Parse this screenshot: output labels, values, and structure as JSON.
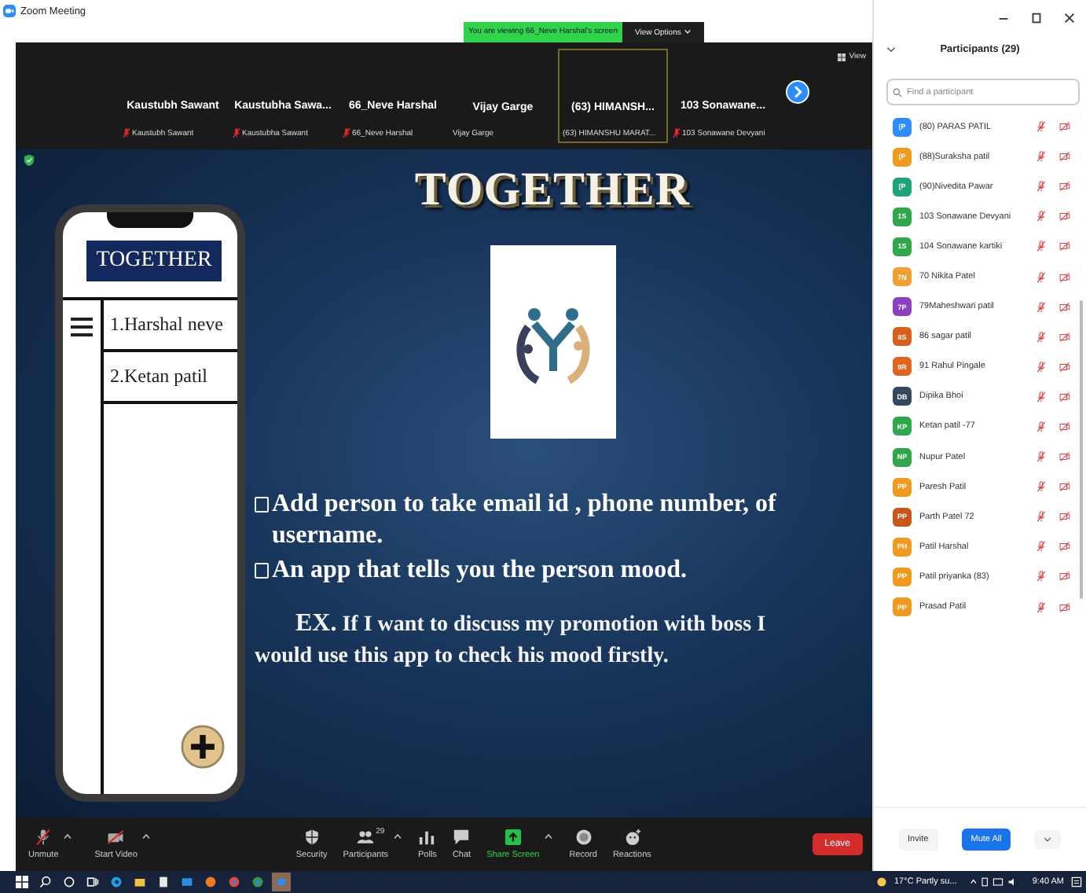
{
  "window": {
    "title": "Zoom Meeting"
  },
  "banner": {
    "text": "You are viewing 66_Neve Harshal's screen",
    "button": "View Options"
  },
  "video_strip": {
    "view_button": "View",
    "tiles": [
      {
        "name": "Kaustubh Sawant",
        "label": "Kaustubh Sawant",
        "muted": true,
        "selected": false
      },
      {
        "name": "Kaustubha Sawa...",
        "label": "Kaustubha Sawant",
        "muted": true,
        "selected": false
      },
      {
        "name": "66_Neve Harshal",
        "label": "66_Neve Harshal",
        "muted": true,
        "selected": false
      },
      {
        "name": "Vijay Garge",
        "label": "Vijay Garge",
        "muted": false,
        "selected": false
      },
      {
        "name": "(63) HIMANSH...",
        "label": "(63) HIMANSHU MARAT...",
        "muted": false,
        "selected": true
      },
      {
        "name": "103 Sonawane...",
        "label": "103 Sonawane Devyani",
        "muted": true,
        "selected": false
      }
    ]
  },
  "shared_screen": {
    "title": "TOGETHER",
    "phone": {
      "header": "TOGETHER",
      "items": [
        "1.Harshal neve",
        "2.Ketan patil"
      ]
    },
    "bullets": [
      "Add person to take email id , phone number, of username.",
      "An app that tells you the person mood."
    ],
    "example": {
      "lead": "EX.",
      "text": "If I want to discuss my promotion with boss I would use this app to check his mood firstly."
    }
  },
  "toolbar": {
    "buttons": [
      {
        "kind": "mic",
        "label": "Unmute",
        "caret": true
      },
      {
        "kind": "video",
        "label": "Start Video",
        "caret": true
      },
      {
        "kind": "security",
        "label": "Security",
        "caret": false
      },
      {
        "kind": "participants",
        "label": "Participants",
        "caret": true,
        "badge": "29"
      },
      {
        "kind": "polls",
        "label": "Polls",
        "caret": false
      },
      {
        "kind": "chat",
        "label": "Chat",
        "caret": false
      },
      {
        "kind": "share",
        "label": "Share Screen",
        "caret": true
      },
      {
        "kind": "record",
        "label": "Record",
        "caret": false
      },
      {
        "kind": "reactions",
        "label": "Reactions",
        "caret": false
      }
    ],
    "leave": "Leave"
  },
  "participants_panel": {
    "title": "Participants (29)",
    "search": {
      "placeholder": "Find a participant"
    },
    "participants": [
      {
        "initials": "(P",
        "name": "(80) PARAS PATIL",
        "color": "#2d8cff"
      },
      {
        "initials": "(P",
        "name": "(88)Suraksha patil",
        "color": "#f29a1d"
      },
      {
        "initials": "(P",
        "name": "(90)Nivedita Pawar",
        "color": "#1fa37a"
      },
      {
        "initials": "1S",
        "name": "103 Sonawane Devyani",
        "color": "#2ea84a"
      },
      {
        "initials": "1S",
        "name": "104 Sonawane kartiki",
        "color": "#2ea84a"
      },
      {
        "initials": "7N",
        "name": "70  Nikita Patel",
        "color": "#f0a030"
      },
      {
        "initials": "7P",
        "name": "79Maheshwari patil",
        "color": "#8a3fc4"
      },
      {
        "initials": "8S",
        "name": "86 sagar patil",
        "color": "#d9601a"
      },
      {
        "initials": "9R",
        "name": "91 Rahul Pingale",
        "color": "#e0641c"
      },
      {
        "initials": "DB",
        "name": "Dipika Bhoi",
        "color": "#34495e"
      },
      {
        "initials": "KP",
        "name": "Ketan patil -77",
        "color": "#2ea84a"
      },
      {
        "initials": "NP",
        "name": "Nupur Patel",
        "color": "#2ea84a"
      },
      {
        "initials": "PP",
        "name": "Paresh Patil",
        "color": "#f29a1d"
      },
      {
        "initials": "PP",
        "name": "Parth Patel 72",
        "color": "#c8561a"
      },
      {
        "initials": "PH",
        "name": "Patil Harshal",
        "color": "#f29a1d"
      },
      {
        "initials": "PP",
        "name": "Patil priyanka (83)",
        "color": "#f29a1d"
      },
      {
        "initials": "PP",
        "name": "Prasad Patil",
        "color": "#f29a1d"
      }
    ],
    "buttons": {
      "invite": "Invite",
      "mute_all": "Mute All"
    }
  },
  "taskbar": {
    "weather": "17°C  Partly su...",
    "time": "9:40 AM"
  }
}
